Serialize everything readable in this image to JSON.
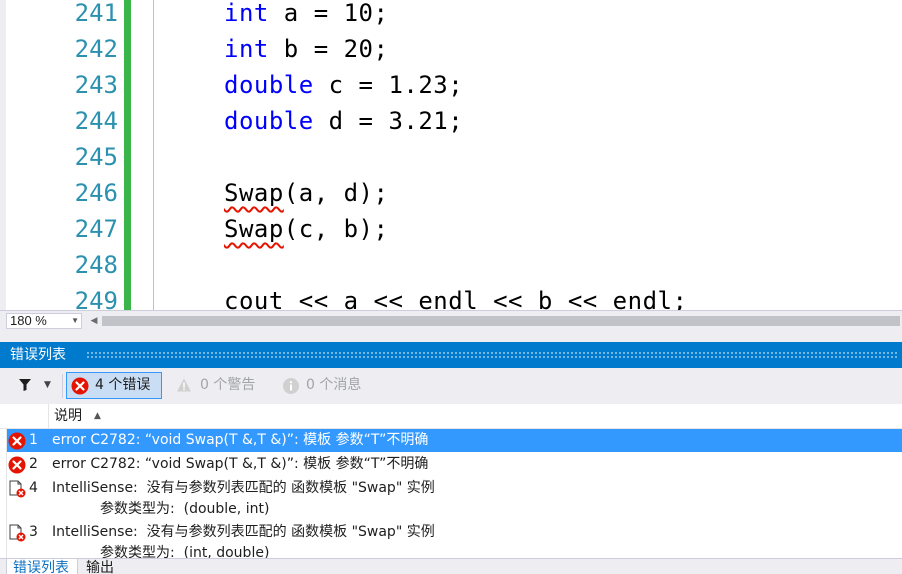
{
  "editor": {
    "lines": [
      {
        "num": "241",
        "kw": "int",
        "rest": " a = 10;"
      },
      {
        "num": "242",
        "kw": "int",
        "rest": " b = 20;"
      },
      {
        "num": "243",
        "kw": "double",
        "rest": " c = 1.23;"
      },
      {
        "num": "244",
        "kw": "double",
        "rest": " d = 3.21;"
      },
      {
        "num": "245",
        "code": ""
      },
      {
        "num": "246",
        "squiggle": "Swap",
        "rest": "(a, d);"
      },
      {
        "num": "247",
        "squiggle": "Swap",
        "rest": "(c, b);"
      },
      {
        "num": "248",
        "code": ""
      },
      {
        "num": "249",
        "code": "cout << a << endl << b << endl;"
      }
    ]
  },
  "zoom": {
    "level": "180 %"
  },
  "error_list": {
    "title": "错误列表",
    "errors_button": "4 个错误",
    "warnings_button": "0 个警告",
    "messages_button": "0 个消息",
    "column_description": "说明",
    "rows": [
      {
        "type": "error",
        "num": "1",
        "text": "error C2782: “void Swap(T &,T &)”: 模板 参数“T”不明确",
        "selected": true
      },
      {
        "type": "error",
        "num": "2",
        "text": "error C2782: “void Swap(T &,T &)”: 模板 参数“T”不明确"
      },
      {
        "type": "intellisense",
        "num": "4",
        "text": "IntelliSense:  没有与参数列表匹配的 函数模板 \"Swap\" 实例",
        "sub": "参数类型为:  (double, int)"
      },
      {
        "type": "intellisense",
        "num": "3",
        "text": "IntelliSense:  没有与参数列表匹配的 函数模板 \"Swap\" 实例",
        "sub": "参数类型为:  (int, double)"
      }
    ]
  },
  "bottom_tabs": {
    "error_list": "错误列表",
    "output": "输出"
  },
  "colors": {
    "keyword": "#0000ff",
    "line_number": "#2b91af",
    "accent": "#007acc",
    "selection": "#3399ff",
    "change_bar": "#3ab54a",
    "error": "#e51400"
  }
}
